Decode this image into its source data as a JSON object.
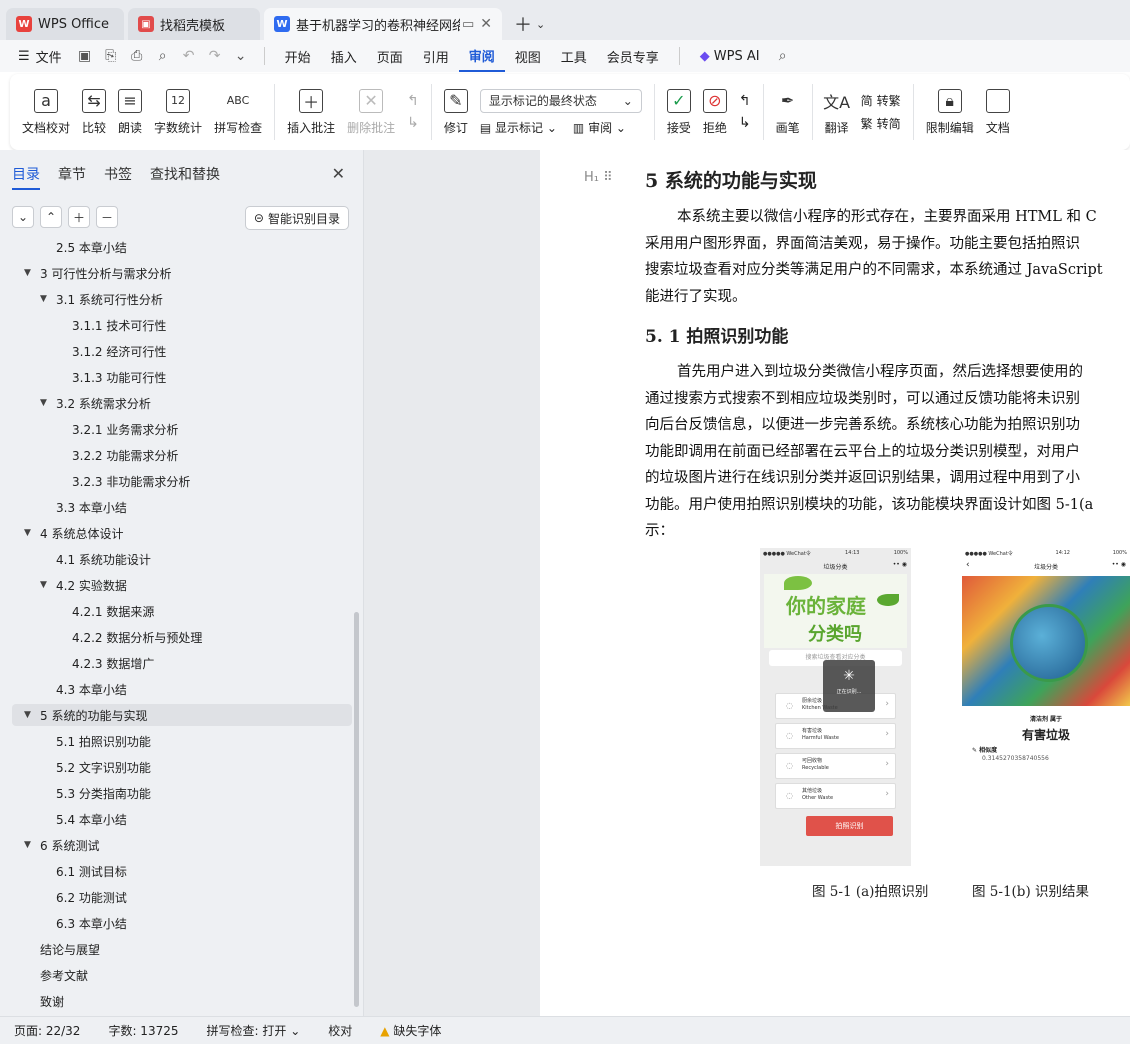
{
  "tabs": [
    {
      "label": "WPS Office"
    },
    {
      "label": "找稻壳模板"
    },
    {
      "label": "基于机器学习的卷积神经网络"
    }
  ],
  "menu": [
    "文件",
    "开始",
    "插入",
    "页面",
    "引用",
    "审阅",
    "视图",
    "工具",
    "会员专享",
    "WPS AI"
  ],
  "ribbon": {
    "doc_check": "文档校对",
    "compare": "比较",
    "read_aloud": "朗读",
    "word_count": "字数统计",
    "spell_check": "拼写检查",
    "insert_comment": "插入批注",
    "delete_comment": "删除批注",
    "track_changes": "修订",
    "show_final": "显示标记的最终状态",
    "show_markup": "显示标记",
    "review": "审阅",
    "accept": "接受",
    "reject": "拒绝",
    "pen": "画笔",
    "translate": "翻译",
    "to_traditional": "转繁",
    "to_simplified": "转简",
    "restrict_edit": "限制编辑",
    "doc_right": "文档"
  },
  "leftpanel": {
    "tabs": [
      "目录",
      "章节",
      "书签",
      "查找和替换"
    ],
    "smart_toc": "智能识别目录",
    "toc": [
      {
        "text": "2.5 本章小结",
        "level": 2,
        "toggle": ""
      },
      {
        "text": "3 可行性分析与需求分析",
        "level": 1,
        "toggle": "▼"
      },
      {
        "text": "3.1  系统可行性分析",
        "level": 2,
        "toggle": "▼"
      },
      {
        "text": "3.1.1 技术可行性",
        "level": 3,
        "toggle": ""
      },
      {
        "text": "3.1.2 经济可行性",
        "level": 3,
        "toggle": ""
      },
      {
        "text": "3.1.3 功能可行性",
        "level": 3,
        "toggle": ""
      },
      {
        "text": "3.2  系统需求分析",
        "level": 2,
        "toggle": "▼"
      },
      {
        "text": "3.2.1  业务需求分析",
        "level": 3,
        "toggle": ""
      },
      {
        "text": "3.2.2  功能需求分析",
        "level": 3,
        "toggle": ""
      },
      {
        "text": "3.2.3  非功能需求分析",
        "level": 3,
        "toggle": ""
      },
      {
        "text": "3.3  本章小结",
        "level": 2,
        "toggle": ""
      },
      {
        "text": "4  系统总体设计",
        "level": 1,
        "toggle": "▼"
      },
      {
        "text": "4.1  系统功能设计",
        "level": 2,
        "toggle": ""
      },
      {
        "text": "4.2  实验数据",
        "level": 2,
        "toggle": "▼"
      },
      {
        "text": "4.2.1  数据来源",
        "level": 3,
        "toggle": ""
      },
      {
        "text": "4.2.2  数据分析与预处理",
        "level": 3,
        "toggle": ""
      },
      {
        "text": "4.2.3  数据增广",
        "level": 3,
        "toggle": ""
      },
      {
        "text": "4.3  本章小结",
        "level": 2,
        "toggle": ""
      },
      {
        "text": "5  系统的功能与实现",
        "level": 1,
        "toggle": "▼",
        "selected": true
      },
      {
        "text": "5.1  拍照识别功能",
        "level": 2,
        "toggle": ""
      },
      {
        "text": "5.2  文字识别功能",
        "level": 2,
        "toggle": ""
      },
      {
        "text": "5.3  分类指南功能",
        "level": 2,
        "toggle": ""
      },
      {
        "text": "5.4  本章小结",
        "level": 2,
        "toggle": ""
      },
      {
        "text": "6  系统测试",
        "level": 1,
        "toggle": "▼"
      },
      {
        "text": "6.1  测试目标",
        "level": 2,
        "toggle": ""
      },
      {
        "text": "6.2  功能测试",
        "level": 2,
        "toggle": ""
      },
      {
        "text": "6.3  本章小结",
        "level": 2,
        "toggle": ""
      },
      {
        "text": "结论与展望",
        "level": 1,
        "toggle": ""
      },
      {
        "text": "参考文献",
        "level": 1,
        "toggle": ""
      },
      {
        "text": "致谢",
        "level": 1,
        "toggle": ""
      }
    ]
  },
  "document": {
    "heading1": "5  系统的功能与实现",
    "para1": [
      "本系统主要以微信小程序的形式存在，主要界面采用 HTML 和 C",
      "采用用户图形界面，界面简洁美观，易于操作。功能主要包括拍照识",
      "搜索垃圾查看对应分类等满足用户的不同需求，本系统通过 JavaScript",
      "能进行了实现。"
    ],
    "heading2": "5. 1  拍照识别功能",
    "para2": [
      "首先用户进入到垃圾分类微信小程序页面，然后选择想要使用的",
      "通过搜索方式搜索不到相应垃圾类别时，可以通过反馈功能将未识别",
      "向后台反馈信息，以便进一步完善系统。系统核心功能为拍照识别功",
      "功能即调用在前面已经部署在云平台上的垃圾分类识别模型，对用户",
      "的垃圾图片进行在线识别分类并返回识别结果，调用过程中用到了小",
      "功能。用户使用拍照识别模块的功能，该功能模块界面设计如图 5-1(a",
      "示："
    ],
    "fig1": {
      "status_left": "●●●●● WeChat令",
      "time": "14:13",
      "battery": "100%",
      "title": "垃圾分类",
      "banner_line1": "你的家庭",
      "banner_line2": "分类吗",
      "search_placeholder": "搜索垃圾查看对应分类",
      "loading": "正在识别...",
      "categories": [
        {
          "cn": "厨余垃圾",
          "en": "Kitchen Waste"
        },
        {
          "cn": "有害垃圾",
          "en": "Harmful Waste"
        },
        {
          "cn": "可回收物",
          "en": "Recyclable"
        },
        {
          "cn": "其他垃圾",
          "en": "Other Waste"
        }
      ],
      "photo_button": "拍照识别"
    },
    "fig2": {
      "status_left": "●●●●● WeChat令",
      "time": "14:12",
      "battery": "100%",
      "title": "垃圾分类",
      "item_name": "清洁剂 属于",
      "category": "有害垃圾",
      "similarity_label": "相似度",
      "similarity": "0.3145270358740556"
    },
    "caption_a": "图 5-1 (a)拍照识别",
    "caption_b": "图 5-1(b)  识别结果"
  },
  "status": {
    "page": "页面: 22/32",
    "words": "字数: 13725",
    "spell": "拼写检查: 打开",
    "proof": "校对",
    "missing_font": "缺失字体"
  },
  "colors": {
    "accent": "#1f5bd7",
    "wps_red": "#e8423d",
    "button_red": "#e0524a"
  }
}
